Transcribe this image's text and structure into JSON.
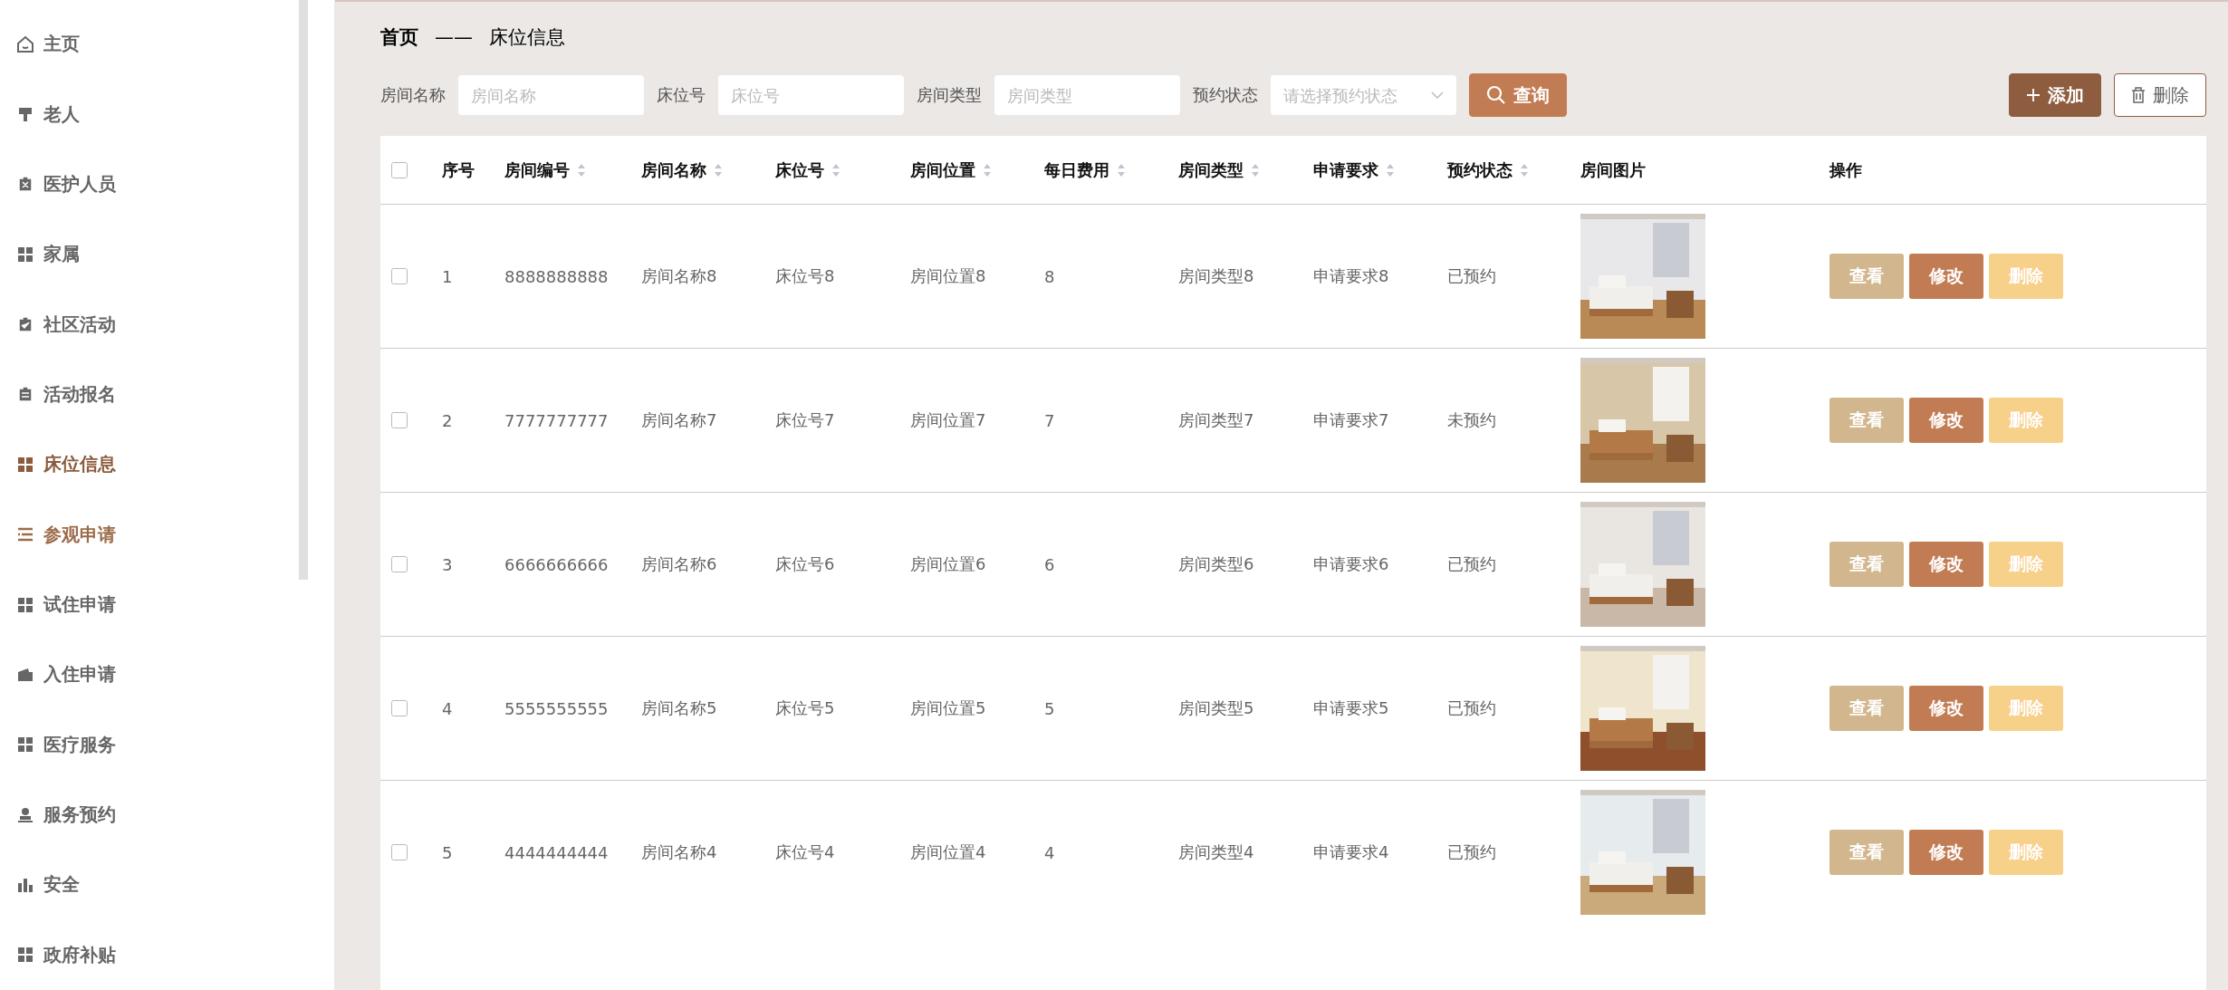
{
  "sidebar": {
    "items": [
      {
        "label": "主页",
        "selected": false,
        "hovered": false
      },
      {
        "label": "老人",
        "selected": false,
        "hovered": false
      },
      {
        "label": "医护人员",
        "selected": false,
        "hovered": false
      },
      {
        "label": "家属",
        "selected": false,
        "hovered": false
      },
      {
        "label": "社区活动",
        "selected": false,
        "hovered": false
      },
      {
        "label": "活动报名",
        "selected": false,
        "hovered": false
      },
      {
        "label": "床位信息",
        "selected": true,
        "hovered": false
      },
      {
        "label": "参观申请",
        "selected": false,
        "hovered": true
      },
      {
        "label": "试住申请",
        "selected": false,
        "hovered": false
      },
      {
        "label": "入住申请",
        "selected": false,
        "hovered": false
      },
      {
        "label": "医疗服务",
        "selected": false,
        "hovered": false
      },
      {
        "label": "服务预约",
        "selected": false,
        "hovered": false
      },
      {
        "label": "安全",
        "selected": false,
        "hovered": false
      },
      {
        "label": "政府补贴",
        "selected": false,
        "hovered": false
      }
    ]
  },
  "breadcrumb": {
    "home": "首页",
    "separator": "——",
    "current": "床位信息"
  },
  "filters": [
    {
      "label": "房间名称",
      "placeholder": "房间名称",
      "kind": "input"
    },
    {
      "label": "床位号",
      "placeholder": "床位号",
      "kind": "input"
    },
    {
      "label": "房间类型",
      "placeholder": "房间类型",
      "kind": "input"
    },
    {
      "label": "预约状态",
      "placeholder": "请选择预约状态",
      "kind": "select"
    }
  ],
  "search_button": "查询",
  "add_button": "添加",
  "delete_button": "删除",
  "table": {
    "select_all_checked": false,
    "columns": [
      {
        "label": "序号",
        "sortable": false
      },
      {
        "label": "房间编号",
        "sortable": true
      },
      {
        "label": "房间名称",
        "sortable": true
      },
      {
        "label": "床位号",
        "sortable": true
      },
      {
        "label": "房间位置",
        "sortable": true
      },
      {
        "label": "每日费用",
        "sortable": true
      },
      {
        "label": "房间类型",
        "sortable": true
      },
      {
        "label": "申请要求",
        "sortable": true
      },
      {
        "label": "预约状态",
        "sortable": true
      },
      {
        "label": "房间图片",
        "sortable": false
      },
      {
        "label": "操作",
        "sortable": false
      }
    ],
    "rows": [
      {
        "checked": false,
        "cells": [
          "1",
          "8888888888",
          "房间名称8",
          "床位号8",
          "房间位置8",
          "8",
          "房间类型8",
          "申请要求8",
          "已预约"
        ],
        "actions": [
          {
            "label": "查看",
            "kind": "view"
          },
          {
            "label": "修改",
            "kind": "edit"
          },
          {
            "label": "删除",
            "kind": "delete"
          }
        ]
      },
      {
        "checked": false,
        "cells": [
          "2",
          "7777777777",
          "房间名称7",
          "床位号7",
          "房间位置7",
          "7",
          "房间类型7",
          "申请要求7",
          "未预约"
        ],
        "actions": [
          {
            "label": "查看",
            "kind": "view"
          },
          {
            "label": "修改",
            "kind": "edit"
          },
          {
            "label": "删除",
            "kind": "delete"
          }
        ]
      },
      {
        "checked": false,
        "cells": [
          "3",
          "6666666666",
          "房间名称6",
          "床位号6",
          "房间位置6",
          "6",
          "房间类型6",
          "申请要求6",
          "已预约"
        ],
        "actions": [
          {
            "label": "查看",
            "kind": "view"
          },
          {
            "label": "修改",
            "kind": "edit"
          },
          {
            "label": "删除",
            "kind": "delete"
          }
        ]
      },
      {
        "checked": false,
        "cells": [
          "4",
          "5555555555",
          "房间名称5",
          "床位号5",
          "房间位置5",
          "5",
          "房间类型5",
          "申请要求5",
          "已预约"
        ],
        "actions": [
          {
            "label": "查看",
            "kind": "view"
          },
          {
            "label": "修改",
            "kind": "edit"
          },
          {
            "label": "删除",
            "kind": "delete"
          }
        ]
      },
      {
        "checked": false,
        "cells": [
          "5",
          "4444444444",
          "房间名称4",
          "床位号4",
          "房间位置4",
          "4",
          "房间类型4",
          "申请要求4",
          "已预约"
        ],
        "actions": [
          {
            "label": "查看",
            "kind": "view"
          },
          {
            "label": "修改",
            "kind": "edit"
          },
          {
            "label": "删除",
            "kind": "delete"
          }
        ]
      }
    ]
  }
}
